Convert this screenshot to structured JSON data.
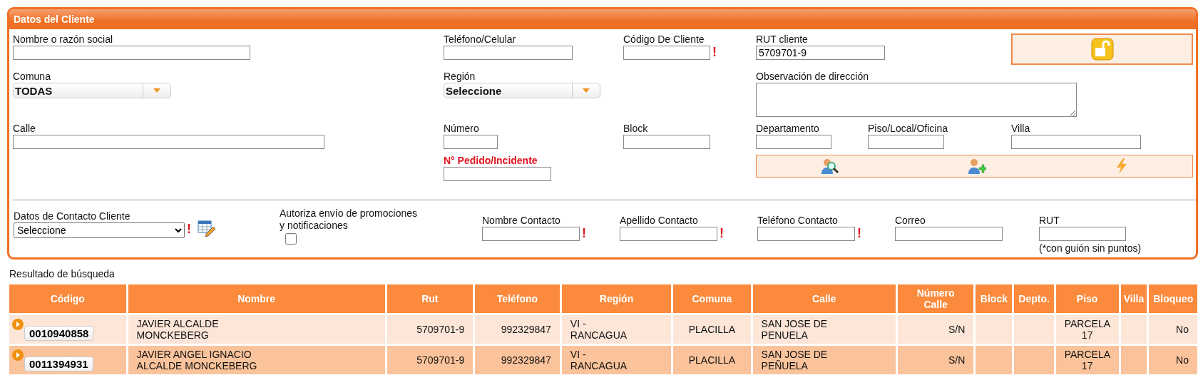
{
  "panel": {
    "title": "Datos del Cliente"
  },
  "form": {
    "fields": [
      {
        "label": "Nombre o razón social",
        "kind": "text",
        "emphasis": false
      },
      {
        "label": "Teléfono/Celular",
        "kind": "text",
        "emphasis": false
      },
      {
        "label": "Código De Cliente",
        "kind": "text",
        "mark": "!",
        "emphasis": false
      },
      {
        "label": "RUT cliente",
        "kind": "text",
        "value": "5709701-9",
        "emphasis": false
      },
      {
        "label": "Comuna",
        "kind": "combo",
        "value": "TODAS",
        "emphasis": false
      },
      {
        "label": "Región",
        "kind": "combo",
        "value": "Seleccione",
        "emphasis": false
      },
      {
        "label": "Observación de dirección",
        "kind": "textarea",
        "emphasis": false
      },
      {
        "label": "Calle",
        "kind": "text",
        "emphasis": false
      },
      {
        "label": "Número",
        "kind": "text",
        "emphasis": false
      },
      {
        "label": "N° Pedido/Incidente",
        "kind": "text",
        "emphasis": true
      },
      {
        "label": "Block",
        "kind": "text",
        "emphasis": false
      },
      {
        "label": "Departamento",
        "kind": "text",
        "emphasis": false
      },
      {
        "label": "Piso/Local/Oficina",
        "kind": "text",
        "emphasis": false
      },
      {
        "label": "Villa",
        "kind": "text",
        "emphasis": false
      }
    ]
  },
  "contact": {
    "fields": [
      {
        "label": "Datos de Contacto Cliente",
        "kind": "select",
        "value": "Seleccione",
        "mark": "!"
      },
      {
        "label": "Autoriza envío de promociones y notificaciones",
        "kind": "checkbox",
        "checked": false
      },
      {
        "label": "Nombre Contacto",
        "kind": "text",
        "mark": "!"
      },
      {
        "label": "Apellido Contacto",
        "kind": "text",
        "mark": "!"
      },
      {
        "label": "Teléfono Contacto",
        "kind": "text",
        "mark": "!"
      },
      {
        "label": "Correo",
        "kind": "text"
      },
      {
        "label": "RUT",
        "kind": "text",
        "hint": "(*con guión sin puntos)"
      }
    ]
  },
  "results": {
    "title": "Resultado de búsqueda",
    "columns": [
      "Código",
      "Nombre",
      "Rut",
      "Teléfono",
      "Región",
      "Comuna",
      "Calle",
      "Número Calle",
      "Block",
      "Depto.",
      "Piso",
      "Villa",
      "Bloqueo"
    ],
    "rows": [
      {
        "cells": [
          "0010940858",
          "JAVIER ALCALDE MONCKEBERG",
          "5709701-9",
          "992329847",
          "VI - RANCAGUA",
          "PLACILLA",
          "SAN JOSE DE PENUELA",
          "S/N",
          "",
          "",
          "PARCELA 17",
          "",
          "No"
        ]
      },
      {
        "cells": [
          "0011394931",
          "JAVIER ANGEL IGNACIO ALCALDE MONCKEBERG",
          "5709701-9",
          "992329847",
          "VI - RANCAGUA",
          "PLACILLA",
          "SAN JOSE DE PEÑUELA",
          "S/N",
          "",
          "",
          "PARCELA 17",
          "",
          "No"
        ]
      }
    ]
  }
}
